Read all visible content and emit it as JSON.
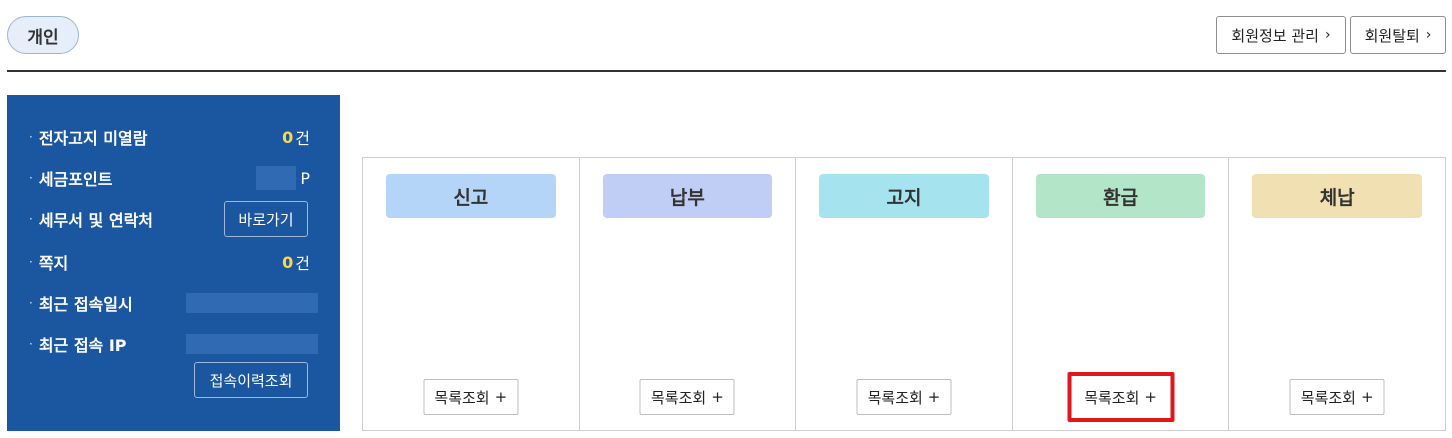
{
  "header": {
    "tab_label": "개인",
    "member_info_label": "회원정보 관리",
    "withdraw_label": "회원탈퇴",
    "chevron": "›"
  },
  "sidebar": {
    "rows": [
      {
        "label": "전자고지 미열람",
        "count": "0",
        "unit": "건"
      },
      {
        "label": "세금포인트",
        "unit": "P"
      },
      {
        "label": "세무서 및 연락처",
        "button": "바로가기"
      },
      {
        "label": "쪽지",
        "count": "0",
        "unit": "건"
      },
      {
        "label": "최근 접속일시"
      },
      {
        "label": "최근 접속 IP"
      }
    ],
    "history_button": "접속이력조회",
    "bullet": "·"
  },
  "categories": [
    {
      "label": "신고",
      "color": "#b5d5f8",
      "button": "목록조회",
      "plus": "+"
    },
    {
      "label": "납부",
      "color": "#c0cef6",
      "button": "목록조회",
      "plus": "+"
    },
    {
      "label": "고지",
      "color": "#a5e3ee",
      "button": "목록조회",
      "plus": "+"
    },
    {
      "label": "환급",
      "color": "#b3e6c8",
      "button": "목록조회",
      "plus": "+"
    },
    {
      "label": "체납",
      "color": "#f1e0b2",
      "button": "목록조회",
      "plus": "+"
    }
  ]
}
